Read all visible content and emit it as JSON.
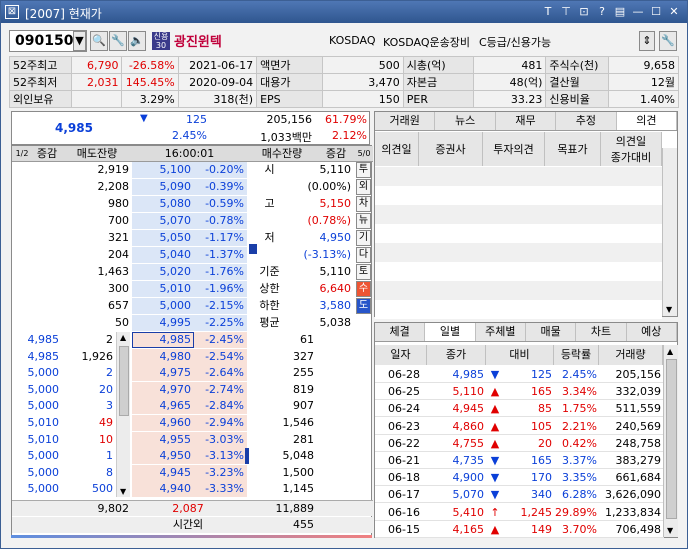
{
  "window": {
    "title": "[2007] 현재가",
    "icons": [
      "checkbox-icon",
      "text-icon",
      "pin-icon",
      "layout-icon",
      "help-icon",
      "list-icon",
      "minimize-icon",
      "maximize-icon",
      "close-icon"
    ],
    "icon_glyphs": [
      "⊠",
      "T",
      "⊤",
      "⊡",
      "?",
      "▤",
      "—",
      "☐",
      "✕"
    ]
  },
  "stock": {
    "code": "090150",
    "name": "광진윈텍",
    "market": "KOSDAQ",
    "sector": "KOSDAQ운송장비",
    "grade": "C등급/신용가능",
    "badge": "신용\n30"
  },
  "info_rows": [
    {
      "l1": "52주최고",
      "v1": "6,790",
      "v2": "-26.58%",
      "v3": "2021-06-17",
      "l2": "액면가",
      "v4": "500",
      "l3": "시총(억)",
      "v5": "481",
      "l4": "주식수(천)",
      "v6": "9,658"
    },
    {
      "l1": "52주최저",
      "v1": "2,031",
      "v2": "145.45%",
      "v3": "2020-09-04",
      "l2": "대용가",
      "v4": "3,470",
      "l3": "자본금",
      "v5": "48(억)",
      "l4": "결산월",
      "v6": "12월"
    },
    {
      "l1": "외인보유",
      "v1": "",
      "v2": "3.29%",
      "v3": "318(천)",
      "l2": "EPS",
      "v4": "150",
      "l3": "PER",
      "v5": "33.23",
      "l4": "신용비율",
      "v6": "1.40%"
    }
  ],
  "price": {
    "current": "4,985",
    "change": "125",
    "rate": "2.45%",
    "volume": "205,156",
    "amount": "1,033백만",
    "vol_rate": "61.79%",
    "amt_rate": "2.12%"
  },
  "orderbook": {
    "headers": {
      "inc1": "증감",
      "ask_rem": "매도잔량",
      "time": "16:00:01",
      "bid_rem": "매수잔량",
      "inc2": "증감"
    },
    "asks": [
      {
        "qty": "2,919",
        "price": "5,100",
        "rate": "-0.20%"
      },
      {
        "qty": "2,208",
        "price": "5,090",
        "rate": "-0.39%"
      },
      {
        "qty": "980",
        "price": "5,080",
        "rate": "-0.59%"
      },
      {
        "qty": "700",
        "price": "5,070",
        "rate": "-0.78%"
      },
      {
        "qty": "321",
        "price": "5,050",
        "rate": "-1.17%"
      },
      {
        "qty": "204",
        "price": "5,040",
        "rate": "-1.37%"
      },
      {
        "qty": "1,463",
        "price": "5,020",
        "rate": "-1.76%"
      },
      {
        "qty": "300",
        "price": "5,010",
        "rate": "-1.96%"
      },
      {
        "qty": "657",
        "price": "5,000",
        "rate": "-2.15%"
      },
      {
        "qty": "50",
        "price": "4,995",
        "rate": "-2.25%"
      }
    ],
    "summary": [
      {
        "label": "시",
        "value": "5,110",
        "color": "#000"
      },
      {
        "label": "",
        "value": "(0.00%)",
        "color": "#000"
      },
      {
        "label": "고",
        "value": "5,150",
        "color": "#e00000"
      },
      {
        "label": "",
        "value": "(0.78%)",
        "color": "#e00000"
      },
      {
        "label": "저",
        "value": "4,950",
        "color": "#0a3fd8"
      },
      {
        "label": "",
        "value": "(-3.13%)",
        "color": "#0a3fd8"
      },
      {
        "label": "기준",
        "value": "5,110",
        "color": "#000"
      },
      {
        "label": "상한",
        "value": "6,640",
        "color": "#e00000"
      },
      {
        "label": "하한",
        "value": "3,580",
        "color": "#0a3fd8"
      },
      {
        "label": "평균",
        "value": "5,038",
        "color": "#000"
      }
    ],
    "bids": [
      {
        "trade": "4,985",
        "tqty": "2",
        "price": "4,985",
        "rate": "-2.45%",
        "qty": "61"
      },
      {
        "trade": "4,985",
        "tqty": "1,926",
        "price": "4,980",
        "rate": "-2.54%",
        "qty": "327"
      },
      {
        "trade": "5,000",
        "tqty": "2",
        "price": "4,975",
        "rate": "-2.64%",
        "qty": "255"
      },
      {
        "trade": "5,000",
        "tqty": "20",
        "price": "4,970",
        "rate": "-2.74%",
        "qty": "819"
      },
      {
        "trade": "5,000",
        "tqty": "3",
        "price": "4,965",
        "rate": "-2.84%",
        "qty": "907"
      },
      {
        "trade": "5,010",
        "tqty": "49",
        "price": "4,960",
        "rate": "-2.94%",
        "qty": "1,546"
      },
      {
        "trade": "5,010",
        "tqty": "10",
        "price": "4,955",
        "rate": "-3.03%",
        "qty": "281"
      },
      {
        "trade": "5,000",
        "tqty": "1",
        "price": "4,950",
        "rate": "-3.13%",
        "qty": "5,048"
      },
      {
        "trade": "5,000",
        "tqty": "8",
        "price": "4,945",
        "rate": "-3.23%",
        "qty": "1,500"
      },
      {
        "trade": "5,000",
        "tqty": "500",
        "price": "4,940",
        "rate": "-3.33%",
        "qty": "1,145"
      }
    ],
    "totals": {
      "ask": "9,802",
      "diff": "2,087",
      "bid": "11,889"
    },
    "after_hours": {
      "label": "시간외",
      "value": "455"
    },
    "side_buttons": [
      "투",
      "외",
      "차",
      "뉴",
      "기",
      "다",
      "토",
      "수",
      "도"
    ]
  },
  "opinion": {
    "tabs": [
      "거래원",
      "뉴스",
      "재무",
      "추정",
      "의견"
    ],
    "active_tab": 4,
    "columns": [
      "의견일",
      "증권사",
      "투자의견",
      "목표가",
      "의견일\n종가대비"
    ]
  },
  "daily": {
    "tabs": [
      "체결",
      "일별",
      "주체별",
      "매물",
      "차트",
      "예상"
    ],
    "active_tab": 1,
    "columns": [
      "일자",
      "종가",
      "대비",
      "등락률",
      "거래량"
    ],
    "rows": [
      {
        "date": "06-28",
        "close": "4,985",
        "dir": "down",
        "chg": "125",
        "rate": "2.45%",
        "vol": "205,156"
      },
      {
        "date": "06-25",
        "close": "5,110",
        "dir": "up",
        "chg": "165",
        "rate": "3.34%",
        "vol": "332,039"
      },
      {
        "date": "06-24",
        "close": "4,945",
        "dir": "up",
        "chg": "85",
        "rate": "1.75%",
        "vol": "511,559"
      },
      {
        "date": "06-23",
        "close": "4,860",
        "dir": "up",
        "chg": "105",
        "rate": "2.21%",
        "vol": "240,569"
      },
      {
        "date": "06-22",
        "close": "4,755",
        "dir": "up",
        "chg": "20",
        "rate": "0.42%",
        "vol": "248,758"
      },
      {
        "date": "06-21",
        "close": "4,735",
        "dir": "down",
        "chg": "165",
        "rate": "3.37%",
        "vol": "383,279"
      },
      {
        "date": "06-18",
        "close": "4,900",
        "dir": "down",
        "chg": "170",
        "rate": "3.35%",
        "vol": "661,684"
      },
      {
        "date": "06-17",
        "close": "5,070",
        "dir": "down",
        "chg": "340",
        "rate": "6.28%",
        "vol": "3,626,090"
      },
      {
        "date": "06-16",
        "close": "5,410",
        "dir": "upper",
        "chg": "1,245",
        "rate": "29.89%",
        "vol": "1,233,834"
      },
      {
        "date": "06-15",
        "close": "4,165",
        "dir": "up",
        "chg": "149",
        "rate": "3.70%",
        "vol": "706,498"
      }
    ]
  }
}
